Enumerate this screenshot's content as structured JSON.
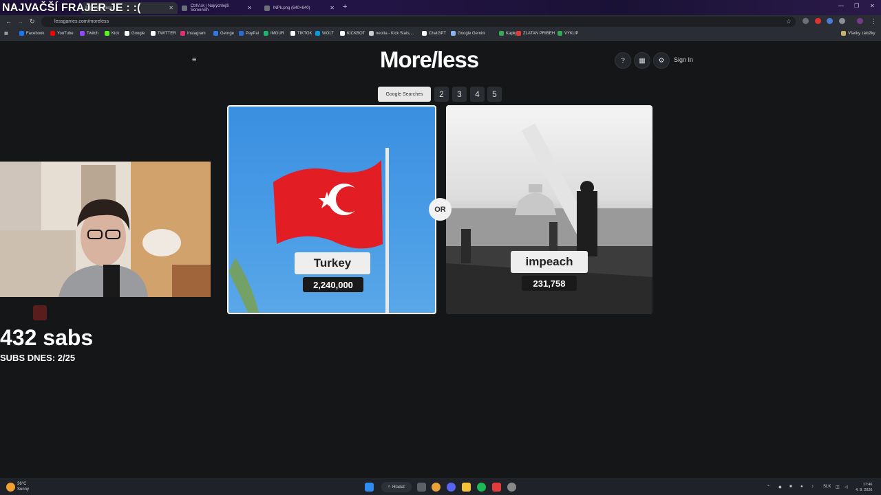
{
  "overlay": {
    "title": "NAJVAČŠÍ FRAJER JE : :("
  },
  "browser": {
    "tabs": [
      {
        "label": "More/less"
      },
      {
        "label": "CtrlV.sk | Najrýchlejší ScreenSh"
      },
      {
        "label": "lNPk.png (640×640)"
      }
    ],
    "url": "lessgames.com/moreless",
    "bookmarks": [
      {
        "label": "Facebook",
        "color": "#1877f2"
      },
      {
        "label": "YouTube",
        "color": "#ff0000"
      },
      {
        "label": "Twitch",
        "color": "#9146ff"
      },
      {
        "label": "Kick",
        "color": "#53fc18"
      },
      {
        "label": "Google",
        "color": "#ffffff"
      },
      {
        "label": "TWITTER",
        "color": "#ffffff"
      },
      {
        "label": "Instagram",
        "color": "#e1306c"
      },
      {
        "label": "George",
        "color": "#2d7be5"
      },
      {
        "label": "PayPal",
        "color": "#2b6cd1"
      },
      {
        "label": "IMGUR",
        "color": "#1bb76e"
      },
      {
        "label": "TIKTOK",
        "color": "#ffffff"
      },
      {
        "label": "WOLT",
        "color": "#009de0"
      },
      {
        "label": "KICKBOT",
        "color": "#ffffff"
      },
      {
        "label": "neotta - Kick Stats,...",
        "color": "#cccccc"
      },
      {
        "label": "ChatGPT",
        "color": "#ffffff"
      },
      {
        "label": "Google Gemini",
        "color": "#8ab4f8"
      },
      {
        "label": "Kapky",
        "color": "#34a853"
      },
      {
        "label": "ZLATAN PRIBEH",
        "color": "#e53935"
      },
      {
        "label": "VYKUP",
        "color": "#34a853"
      }
    ],
    "all_bookmarks": "Všetky záložky"
  },
  "site": {
    "logo": "More/less",
    "help_icon": "?",
    "sign_in": "Sign In",
    "categories": {
      "active": "Google Searches",
      "others": [
        "2",
        "3",
        "4",
        "5"
      ]
    },
    "left": {
      "name": "Turkey",
      "value": "2,240,000"
    },
    "right": {
      "name": "impeach",
      "value": "231,758"
    },
    "or_label": "OR"
  },
  "stream": {
    "subs": "432 sabs",
    "subs_today": "SUBS DNES: 2/25"
  },
  "taskbar": {
    "weather_temp": "36°C",
    "weather_text": "Sunny",
    "search": "Hľadať",
    "lang": "SLK",
    "time": "17:46",
    "date": "4. 8. 2026"
  }
}
